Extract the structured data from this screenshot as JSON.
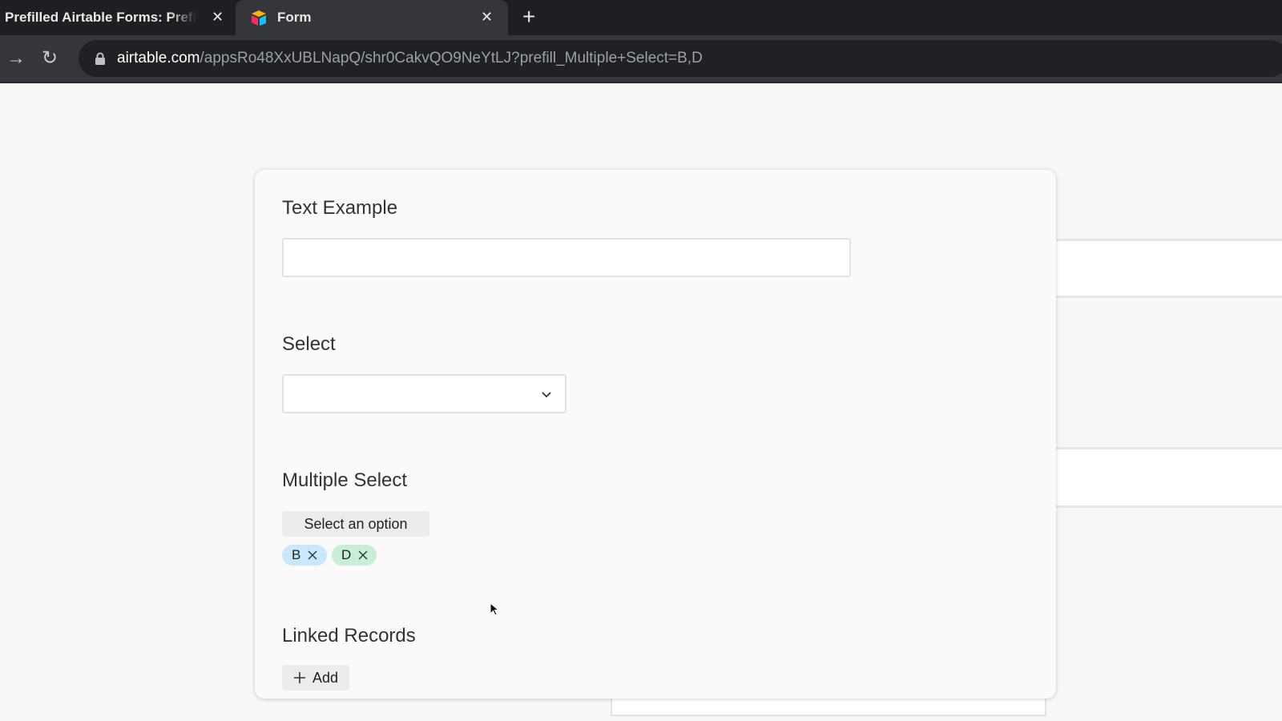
{
  "browser": {
    "tabs": [
      {
        "title": "Prefilled Airtable Forms: Prefill"
      },
      {
        "title": "Form"
      }
    ],
    "close_glyph": "✕",
    "new_tab_glyph": "+",
    "forward_glyph": "→",
    "reload_glyph": "↻",
    "url_host": "airtable.com",
    "url_path": "/appsRo48XxUBLNapQ/shr0CakvQO9NeYtLJ?prefill_Multiple+Select=B,D"
  },
  "form": {
    "text_field": {
      "label": "Text Example",
      "value": ""
    },
    "select_field": {
      "label": "Select",
      "value": ""
    },
    "multiple_select": {
      "label": "Multiple Select",
      "button_label": "Select an option",
      "chips": [
        {
          "label": "B",
          "color": "#c9e8fb"
        },
        {
          "label": "D",
          "color": "#c8efd5"
        }
      ]
    },
    "linked_records": {
      "label": "Linked Records",
      "add_label": "Add"
    }
  },
  "icons": {
    "favicon": "airtable-logo-icon",
    "lock": "lock-icon",
    "chevron": "chevron-down-icon",
    "chip_remove": "close-icon",
    "add": "plus-icon",
    "cursor": "mouse-pointer-icon"
  }
}
